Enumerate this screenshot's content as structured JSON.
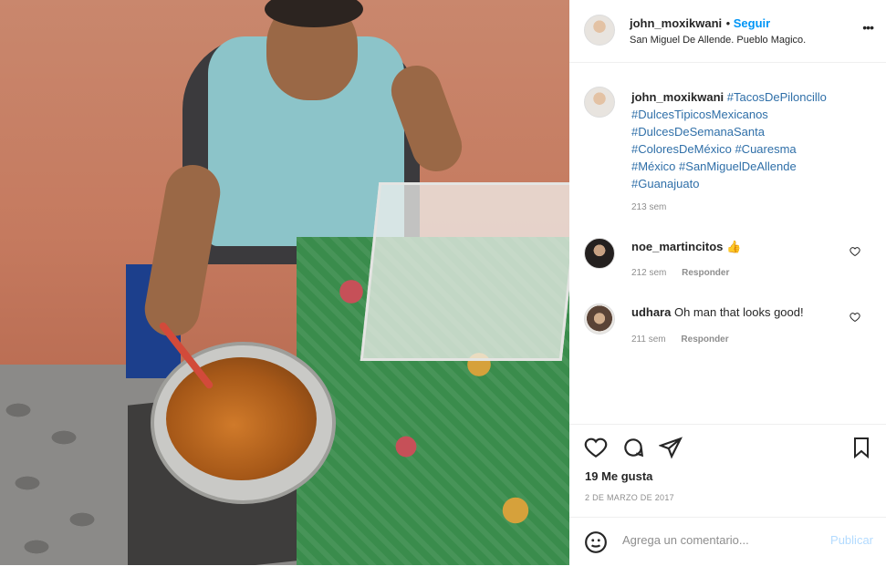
{
  "post": {
    "author": "john_moxikwani",
    "follow_label": "Seguir",
    "location": "San Miguel De Allende. Pueblo Magico.",
    "more_label": "•••"
  },
  "caption": {
    "author": "john_moxikwani",
    "hashtags": [
      "#TacosDePiloncillo",
      "#DulcesTipicosMexicanos",
      "#DulcesDeSemanaSanta",
      "#ColoresDeMéxico",
      "#Cuaresma",
      "#México",
      "#SanMiguelDeAllende",
      "#Guanajuato"
    ],
    "age": "213 sem"
  },
  "comments": [
    {
      "user": "noe_martincitos",
      "text": "👍",
      "age": "212 sem",
      "reply": "Responder"
    },
    {
      "user": "udhara",
      "text": "Oh man that looks good!",
      "age": "211 sem",
      "reply": "Responder"
    }
  ],
  "actions": {
    "likes": "19 Me gusta",
    "date": "2 DE MARZO DE 2017"
  },
  "comment_box": {
    "placeholder": "Agrega un comentario...",
    "publish": "Publicar"
  },
  "icons": {
    "like": "heart-icon",
    "comment": "comment-icon",
    "share": "share-icon",
    "save": "bookmark-icon",
    "emoji": "emoji-icon"
  }
}
